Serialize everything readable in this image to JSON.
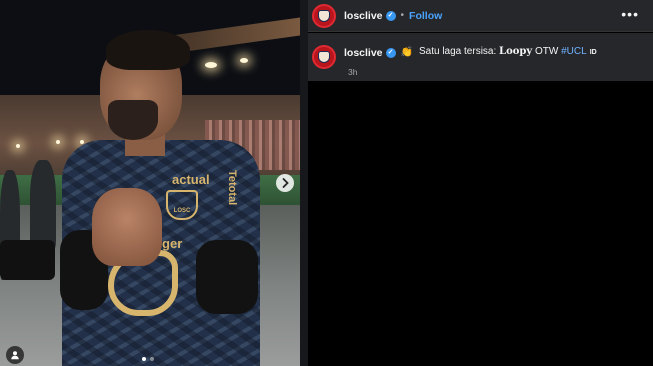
{
  "media": {
    "sponsor_top": "actual",
    "sponsor_side": "Tetotal",
    "sponsor_chest": "Boulanger",
    "crest_text": "LOSC",
    "next_icon": "chevron-right-icon",
    "carousel": {
      "count": 2,
      "active_index": 0
    },
    "tag_icon": "user-icon"
  },
  "post": {
    "username": "losclive",
    "separator": "•",
    "follow_label": "Follow",
    "more_label": "•••",
    "verified_glyph": "✓",
    "caption": {
      "username": "losclive",
      "emoji": "👏",
      "text_before": "Satu laga tersisa:",
      "bold_word": "Loopy",
      "text_after": "OTW",
      "hashtag": "#UCL",
      "flag": "ID"
    },
    "time": "3h"
  },
  "colors": {
    "accent_link": "#4aa3ff",
    "verified": "#3897f0",
    "header_bg": "#26272b",
    "avatar_red": "#b8151d",
    "kit_gold": "#d7b56d"
  }
}
